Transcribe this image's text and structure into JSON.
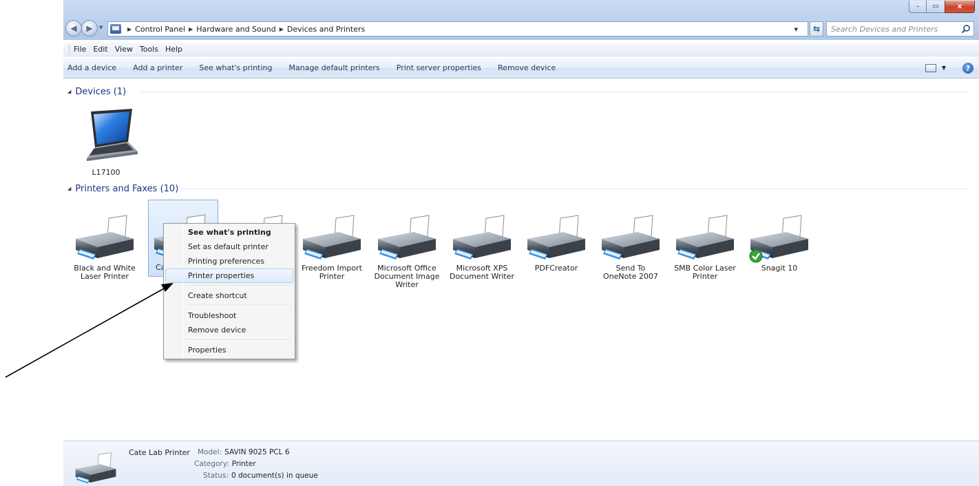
{
  "window": {
    "controls": {
      "minimize": "–",
      "maximize": "▭",
      "close": "x"
    }
  },
  "address": {
    "breadcrumbs": [
      "Control Panel",
      "Hardware and Sound",
      "Devices and Printers"
    ],
    "search_placeholder": "Search Devices and Printers"
  },
  "menu": [
    "File",
    "Edit",
    "View",
    "Tools",
    "Help"
  ],
  "commands": [
    "Add a device",
    "Add a printer",
    "See what's printing",
    "Manage default printers",
    "Print server properties",
    "Remove device"
  ],
  "groups": {
    "devices": {
      "title": "Devices (1)",
      "items": [
        "L17100"
      ]
    },
    "printers": {
      "title": "Printers and Faxes (10)",
      "items": [
        {
          "line1": "Black and  White",
          "line2": "Laser Printer",
          "line3": ""
        },
        {
          "line1": "Ca",
          "line2": "",
          "line3": ""
        },
        {
          "line1": "",
          "line2": "",
          "line3": ""
        },
        {
          "line1": "Freedom Import",
          "line2": "Printer",
          "line3": ""
        },
        {
          "line1": "Microsoft Office",
          "line2": "Document Image",
          "line3": "Writer"
        },
        {
          "line1": "Microsoft XPS",
          "line2": "Document Writer",
          "line3": ""
        },
        {
          "line1": "PDFCreator",
          "line2": "",
          "line3": ""
        },
        {
          "line1": "Send To",
          "line2": "OneNote 2007",
          "line3": ""
        },
        {
          "line1": "SMB Color Laser",
          "line2": "Printer",
          "line3": ""
        },
        {
          "line1": "Snagit 10",
          "line2": "",
          "line3": ""
        }
      ]
    }
  },
  "context_menu": {
    "items": [
      "See what's printing",
      "Set as default printer",
      "Printing preferences",
      "Printer properties",
      "Create shortcut",
      "Troubleshoot",
      "Remove device",
      "Properties"
    ],
    "hovered": "Printer properties"
  },
  "details": {
    "name": "Cate Lab Printer",
    "model_label": "Model:",
    "model_value": "SAVIN 9025 PCL 6",
    "category_label": "Category:",
    "category_value": "Printer",
    "status_label": "Status:",
    "status_value": "0 document(s) in queue"
  },
  "colors": {
    "group_header": "#1e3287",
    "selection_fill": "#cfe2f9",
    "selection_border": "#84acdd",
    "default_badge": "#3aa23a"
  }
}
